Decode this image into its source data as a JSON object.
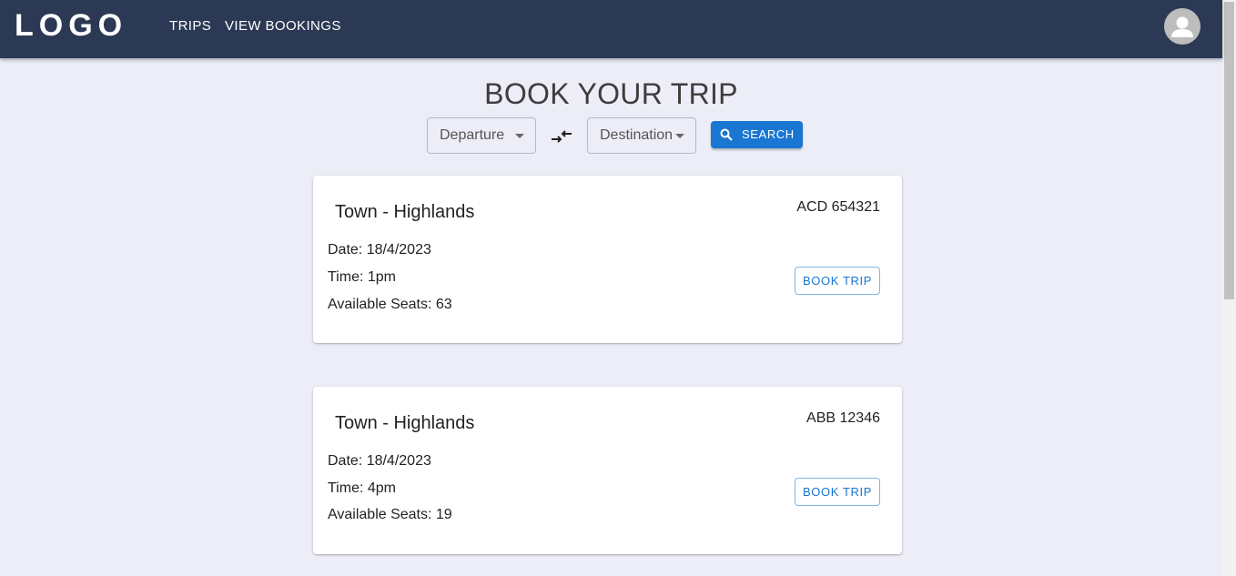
{
  "header": {
    "logo": "LOGO",
    "nav": [
      {
        "label": "TRIPS"
      },
      {
        "label": "VIEW BOOKINGS"
      }
    ]
  },
  "page": {
    "title": "BOOK YOUR TRIP"
  },
  "search": {
    "departure_label": "Departure",
    "destination_label": "Destination",
    "search_label": "SEARCH"
  },
  "trips": [
    {
      "route": "Town - Highlands",
      "code": "ACD 654321",
      "date": "Date: 18/4/2023",
      "time": "Time: 1pm",
      "seats": "Available Seats: 63",
      "book_label": "BOOK TRIP"
    },
    {
      "route": "Town - Highlands",
      "code": "ABB 12346",
      "date": "Date: 18/4/2023",
      "time": "Time: 4pm",
      "seats": "Available Seats: 19",
      "book_label": "BOOK TRIP"
    }
  ],
  "colors": {
    "appbar": "#2c3955",
    "background": "#ecedf7",
    "primary": "#1976d2"
  },
  "icons": {
    "swap": "swap-arrows-icon",
    "search": "search-icon",
    "avatar": "account-icon",
    "dropdown": "caret-down-icon"
  }
}
